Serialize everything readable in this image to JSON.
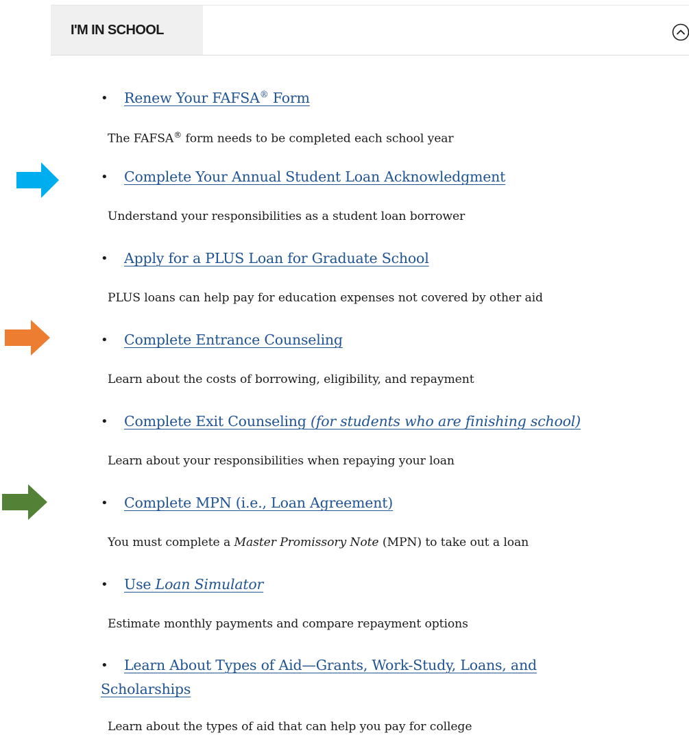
{
  "accordion": {
    "title": "I'M IN SCHOOL",
    "toggle_icon": "chevron-up-circle-icon"
  },
  "items": [
    {
      "link_text": "Renew Your FAFSA",
      "superscript": "®",
      "link_suffix": " Form",
      "description_pre": "The FAFSA",
      "description_sup": "®",
      "description_post": " form needs to be completed each school year"
    },
    {
      "link_text": "Complete Your Annual Student Loan Acknowledgment",
      "description": "Understand your responsibilities as a student loan borrower",
      "marker": {
        "color": "#00aeef",
        "icon": "arrow-right-icon"
      }
    },
    {
      "link_text": "Apply for a PLUS Loan for Graduate School",
      "description": "PLUS loans can help pay for education expenses not covered by other aid"
    },
    {
      "link_text": "Complete Entrance Counseling",
      "description": "Learn about the costs of borrowing, eligibility, and repayment",
      "marker": {
        "color": "#ed7d31",
        "icon": "arrow-right-icon"
      }
    },
    {
      "link_text": "Complete Exit Counseling ",
      "link_italic": "(for students who are finishing school)",
      "description": "Learn about your responsibilities when repaying your loan"
    },
    {
      "link_text": "Complete MPN (i.e., Loan Agreement)",
      "description_pre": "You must complete a ",
      "description_italic": "Master Promissory Note",
      "description_post": " (MPN) to take out a loan",
      "marker": {
        "color": "#538135",
        "icon": "arrow-right-icon"
      }
    },
    {
      "link_text": "Use ",
      "link_italic": "Loan Simulator",
      "description": "Estimate monthly payments and compare repayment options"
    },
    {
      "link_text": "Learn About Types of Aid—Grants, Work-Study, Loans, and Scholarships",
      "description": "Learn about the types of aid that can help you pay for college"
    }
  ],
  "bullet": "•",
  "colors": {
    "link": "#205493",
    "text": "#1b1b1b",
    "header_bg": "#f0f0f0"
  }
}
